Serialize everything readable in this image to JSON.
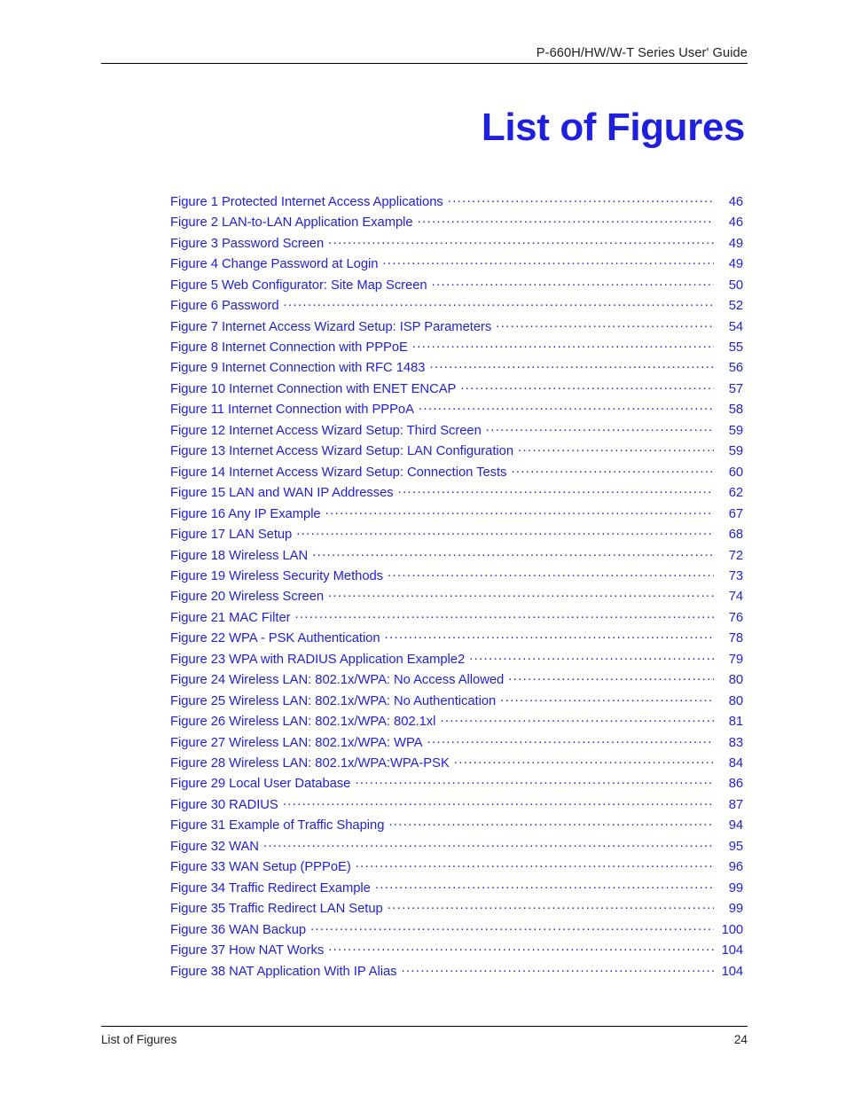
{
  "header": {
    "title": "P-660H/HW/W-T Series User' Guide"
  },
  "title": "List of Figures",
  "colors": {
    "link_blue": "#1f1fe0",
    "title_blue": "#1f1fe0",
    "rule_black": "#000000",
    "text_black": "#231f20"
  },
  "toc": {
    "entries": [
      {
        "label": "Figure 1 Protected Internet Access Applications",
        "page": "46"
      },
      {
        "label": "Figure 2 LAN-to-LAN Application Example",
        "page": "46"
      },
      {
        "label": "Figure 3 Password Screen",
        "page": "49"
      },
      {
        "label": "Figure 4 Change Password at Login",
        "page": "49"
      },
      {
        "label": "Figure 5  Web Configurator: Site Map Screen",
        "page": "50"
      },
      {
        "label": "Figure 6 Password",
        "page": "52"
      },
      {
        "label": "Figure 7 Internet Access Wizard Setup: ISP Parameters",
        "page": "54"
      },
      {
        "label": "Figure 8 Internet Connection with PPPoE",
        "page": "55"
      },
      {
        "label": "Figure 9  Internet Connection with RFC 1483",
        "page": "56"
      },
      {
        "label": "Figure 10 Internet Connection with ENET ENCAP",
        "page": "57"
      },
      {
        "label": "Figure 11 Internet Connection with PPPoA",
        "page": "58"
      },
      {
        "label": "Figure 12 Internet Access Wizard Setup: Third Screen",
        "page": "59"
      },
      {
        "label": "Figure 13 Internet Access Wizard Setup: LAN Configuration",
        "page": "59"
      },
      {
        "label": "Figure 14 Internet Access Wizard Setup: Connection Tests",
        "page": "60"
      },
      {
        "label": "Figure 15 LAN and WAN IP Addresses",
        "page": "62"
      },
      {
        "label": "Figure 16 Any IP Example",
        "page": "67"
      },
      {
        "label": "Figure 17 LAN Setup",
        "page": "68"
      },
      {
        "label": "Figure 18 Wireless LAN",
        "page": "72"
      },
      {
        "label": "Figure 19 Wireless Security Methods",
        "page": "73"
      },
      {
        "label": "Figure 20 Wireless Screen",
        "page": "74"
      },
      {
        "label": "Figure 21 MAC Filter",
        "page": "76"
      },
      {
        "label": "Figure 22 WPA - PSK Authentication",
        "page": "78"
      },
      {
        "label": "Figure 23 WPA with RADIUS Application Example2",
        "page": "79"
      },
      {
        "label": "Figure 24 Wireless LAN: 802.1x/WPA: No Access Allowed",
        "page": "80"
      },
      {
        "label": "Figure 25 Wireless LAN: 802.1x/WPA: No Authentication",
        "page": "80"
      },
      {
        "label": "Figure 26 Wireless LAN: 802.1x/WPA: 802.1xl",
        "page": "81"
      },
      {
        "label": "Figure 27 Wireless LAN: 802.1x/WPA: WPA",
        "page": "83"
      },
      {
        "label": "Figure 28 Wireless LAN: 802.1x/WPA:WPA-PSK",
        "page": "84"
      },
      {
        "label": "Figure 29 Local User Database",
        "page": "86"
      },
      {
        "label": "Figure 30 RADIUS",
        "page": "87"
      },
      {
        "label": "Figure 31 Example of Traffic Shaping",
        "page": "94"
      },
      {
        "label": "Figure 32 WAN",
        "page": "95"
      },
      {
        "label": "Figure 33 WAN Setup (PPPoE)",
        "page": "96"
      },
      {
        "label": "Figure 34 Traffic Redirect Example",
        "page": "99"
      },
      {
        "label": "Figure 35 Traffic Redirect LAN Setup",
        "page": "99"
      },
      {
        "label": "Figure 36 WAN Backup",
        "page": "100"
      },
      {
        "label": "Figure 37 How NAT Works",
        "page": "104"
      },
      {
        "label": "Figure 38 NAT Application With IP Alias",
        "page": "104"
      }
    ]
  },
  "footer": {
    "left": "List of Figures",
    "page_number": "24"
  }
}
